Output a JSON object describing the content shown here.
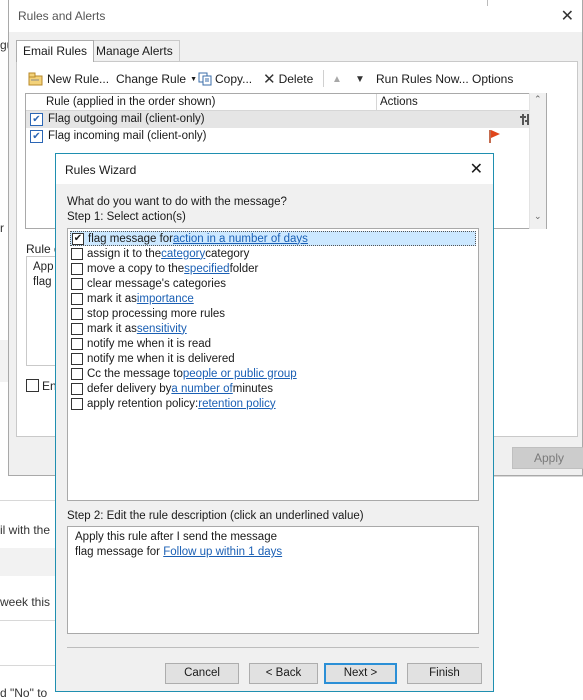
{
  "background": {
    "fragments": [
      "gu",
      "r",
      "il with the",
      "week this",
      "d \"No\" to"
    ]
  },
  "rules_and_alerts": {
    "title": "Rules and Alerts",
    "tabs": [
      "Email Rules",
      "Manage Alerts"
    ],
    "toolbar": {
      "new_rule": "New Rule...",
      "change_rule": "Change Rule",
      "copy": "Copy...",
      "delete": "Delete",
      "move_up": "▲",
      "move_down": "▼",
      "run_rules_now": "Run Rules Now...",
      "options": "Options"
    },
    "list": {
      "col_rule": "Rule (applied in the order shown)",
      "col_actions": "Actions",
      "rows": [
        {
          "label": "Flag outgoing mail  (client-only)",
          "checked": true
        },
        {
          "label": "Flag incoming mail  (client-only)",
          "checked": true
        }
      ]
    },
    "rule_desc_fragment": "Rule d",
    "desc_fragment_1": "App",
    "desc_fragment_2": "flag",
    "enable_fragment": "En",
    "apply_label": "Apply",
    "flag_color": "#e0461b"
  },
  "wizard": {
    "title": "Rules Wizard",
    "question": "What do you want to do with the message?",
    "step1": "Step 1: Select action(s)",
    "actions": [
      {
        "pre": "flag message for ",
        "link": "action in a number of days",
        "post": "",
        "checked": true,
        "selected": true
      },
      {
        "pre": "assign it to the ",
        "link": "category",
        "post": " category",
        "checked": false
      },
      {
        "pre": "move a copy to the ",
        "link": "specified",
        "post": " folder",
        "checked": false
      },
      {
        "pre": "clear message's categories",
        "link": "",
        "post": "",
        "checked": false
      },
      {
        "pre": "mark it as ",
        "link": "importance",
        "post": "",
        "checked": false
      },
      {
        "pre": "stop processing more rules",
        "link": "",
        "post": "",
        "checked": false
      },
      {
        "pre": "mark it as ",
        "link": "sensitivity",
        "post": "",
        "checked": false
      },
      {
        "pre": "notify me when it is read",
        "link": "",
        "post": "",
        "checked": false
      },
      {
        "pre": "notify me when it is delivered",
        "link": "",
        "post": "",
        "checked": false
      },
      {
        "pre": "Cc the message to ",
        "link": "people or public group",
        "post": "",
        "checked": false
      },
      {
        "pre": "defer delivery by ",
        "link": "a number of",
        "post": " minutes",
        "checked": false
      },
      {
        "pre": "apply retention policy: ",
        "link": "retention policy",
        "post": "",
        "checked": false
      }
    ],
    "step2": "Step 2: Edit the rule description (click an underlined value)",
    "desc_line1": "Apply this rule after I send the message",
    "desc_line2_pre": "flag message for ",
    "desc_line2_link": "Follow up within 1 days",
    "buttons": {
      "cancel": "Cancel",
      "back": "< Back",
      "next": "Next >",
      "finish": "Finish"
    }
  }
}
